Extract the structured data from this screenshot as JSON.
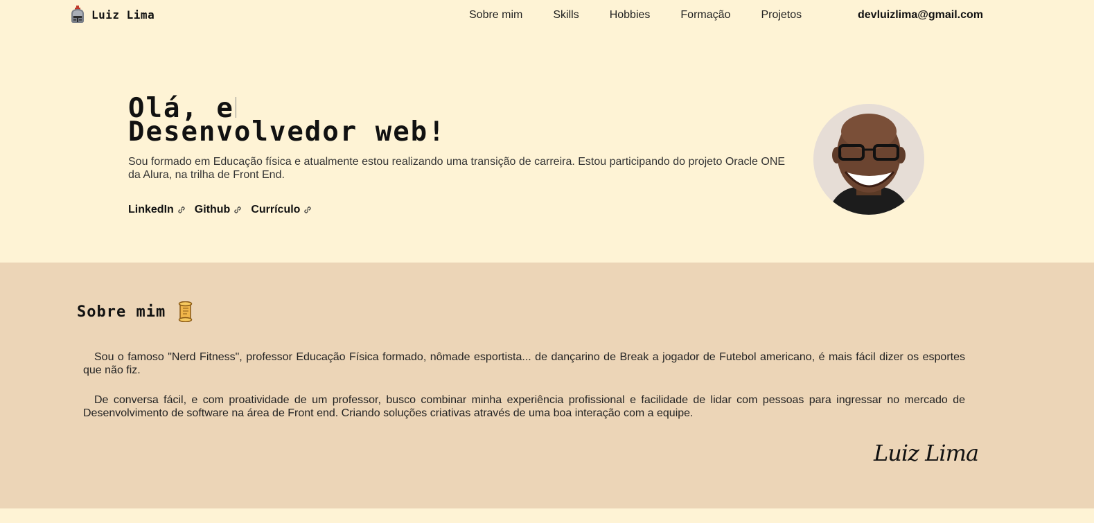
{
  "header": {
    "logo_text": "Luiz Lima",
    "logo_icon": "knight-helmet-icon",
    "nav": [
      {
        "label": "Sobre mim"
      },
      {
        "label": "Skills"
      },
      {
        "label": "Hobbies"
      },
      {
        "label": "Formação"
      },
      {
        "label": "Projetos"
      }
    ],
    "email": "devluizlima@gmail.com"
  },
  "hero": {
    "title_line1": "Olá, e",
    "title_line2": "Desenvolvedor web!",
    "description": "Sou formado em Educação física e atualmente estou realizando uma transição de carreira. Estou participando do projeto Oracle ONE da Alura, na trilha de Front End.",
    "links": [
      {
        "label": "LinkedIn",
        "icon": "link-icon"
      },
      {
        "label": "Github",
        "icon": "link-icon"
      },
      {
        "label": "Currículo",
        "icon": "link-icon"
      }
    ],
    "avatar_icon": "profile-photo"
  },
  "about": {
    "title": "Sobre mim",
    "title_icon": "scroll-icon",
    "paragraph1": "Sou o famoso \"Nerd Fitness\", professor Educação Física formado, nômade esportista... de dançarino de Break a jogador de Futebol americano, é mais fácil dizer os esportes que não fiz.",
    "paragraph2": "De conversa fácil, e com proatividade de um professor, busco combinar minha experiência profissional e facilidade de lidar com pessoas para ingressar no mercado de Desenvolvimento de software na área de Front end. Criando soluções criativas através de uma boa interação com a equipe.",
    "signature": "Luiz Lima"
  },
  "colors": {
    "page_bg": "#fef3d5",
    "about_bg": "#ecd5b7",
    "text": "#222222"
  }
}
